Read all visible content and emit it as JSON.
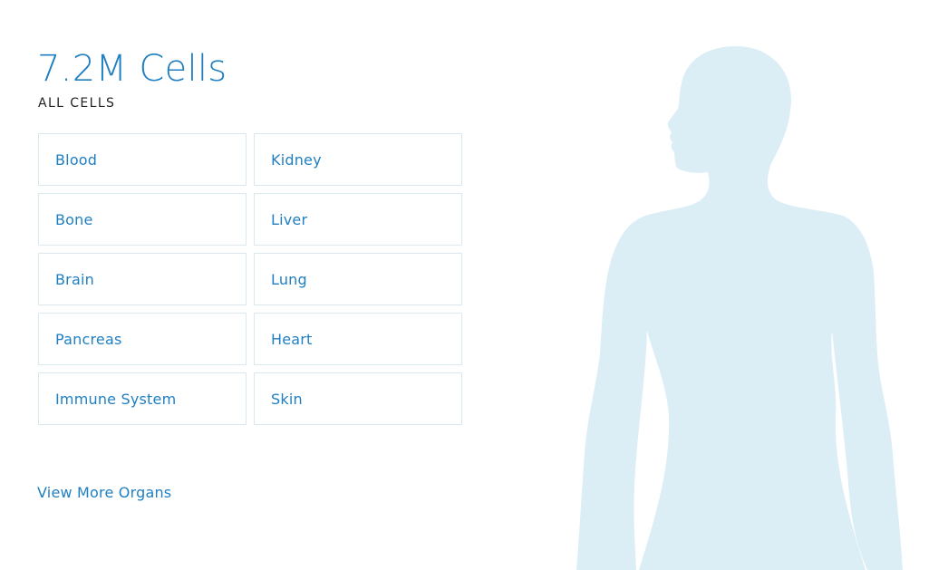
{
  "summary": {
    "count_label": "7.2M Cells",
    "scope_label": "ALL CELLS"
  },
  "organs": [
    {
      "label": "Blood"
    },
    {
      "label": "Kidney"
    },
    {
      "label": "Bone"
    },
    {
      "label": "Liver"
    },
    {
      "label": "Brain"
    },
    {
      "label": "Lung"
    },
    {
      "label": "Pancreas"
    },
    {
      "label": "Heart"
    },
    {
      "label": "Immune System"
    },
    {
      "label": "Skin"
    }
  ],
  "footer": {
    "more_link_label": "View More Organs"
  },
  "colors": {
    "accent": "#1f7fc1",
    "card_border": "#d9e9ef",
    "silhouette": "#dceef5"
  }
}
